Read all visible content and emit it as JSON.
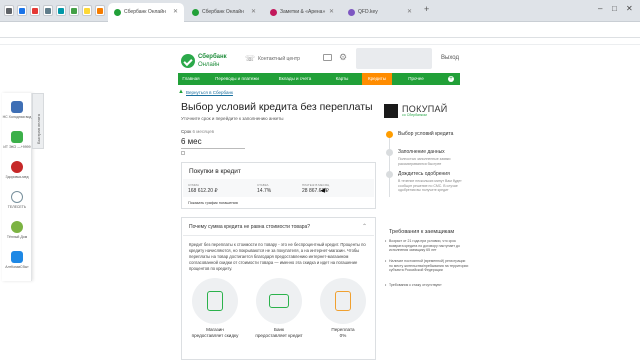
{
  "browser": {
    "tabs": [
      {
        "title": "Сбербанк Онлайн",
        "color": "#21a038",
        "active": true
      },
      {
        "title": "Сбербанк Онлайн",
        "color": "#21a038",
        "active": false
      },
      {
        "title": "Заметки & «Арена»",
        "color": "#c2185b",
        "active": false
      },
      {
        "title": "QFD.key",
        "color": "#7e57c2",
        "active": false
      }
    ],
    "new_tab": "+",
    "window_controls": [
      "–",
      "□",
      "✕"
    ]
  },
  "header": {
    "logo_line1": "Сбербанк",
    "logo_line2": "Онлайн",
    "contact": "Контактный центр",
    "logout": "Выход"
  },
  "nav": {
    "items": [
      "Главная",
      "Переводы и платежи",
      "Вклады и счета",
      "Карты",
      "Кредиты",
      "Прочее"
    ],
    "active_index": 4,
    "plus": "+"
  },
  "breadcrumb": "Вернуться в Сбербанк",
  "sidebar": {
    "tab_label": "Быстрая оплата",
    "items": [
      {
        "label": "НС Холодная вод",
        "color": "#3f6fb5"
      },
      {
        "label": "ИТ ЭКО —+9999",
        "color": "#3cb04a"
      },
      {
        "label": "Здоровья-мед",
        "color": "#c62828"
      },
      {
        "label": "ТЕЛЕСЕТЬ",
        "color": "#78909c"
      },
      {
        "label": "Тёплый Дом",
        "color": "#7cb342"
      },
      {
        "label": "АлтКоммСбыт",
        "color": "#1e88e5"
      }
    ]
  },
  "main": {
    "title": "Выбор условий кредита без переплаты",
    "subtitle": "Уточните срок и перейдите к заполнению анкеты",
    "term_label": "Срок",
    "term_hint": "6 месяцев",
    "term_value": "6 мес",
    "summary": {
      "heading": "Покупки в кредит",
      "cols": [
        {
          "label": "Сумма",
          "value": "168 612.20 ₽"
        },
        {
          "label": "Ставка",
          "value": "14.7%"
        },
        {
          "label": "Платеж в месяц",
          "value": "28 867.63 ₽"
        }
      ],
      "schedule_link": "Показать график погашения"
    },
    "faq": {
      "heading": "Почему сумма кредита не равна стоимости товара?",
      "text": "Кредит без переплаты к стоимости по товару - это не беспроцентный кредит. Проценты по кредиту начисляются, но покрываются не за покупателя, а на интернет-магазин. Чтобы переплаты на товар достигается благодаря предоставлению интернет-магазином согласованной скидки от стоимости товара — именно эта скидка и идет на погашение процентов по кредиту.",
      "features": [
        {
          "line1": "Магазин",
          "line2": "предоставляет скидку",
          "icon": "shop-discount-icon"
        },
        {
          "line1": "Банк",
          "line2": "предоставляет кредит",
          "icon": "bank-card-icon"
        },
        {
          "line1": "Переплата",
          "line2": "0%",
          "icon": "zero-percent-icon"
        }
      ]
    }
  },
  "right": {
    "promo_title": "ПОКУПАЙ",
    "promo_sub": "со Сбербанком",
    "steps": [
      {
        "title": "Выбор условий кредита",
        "desc": "",
        "active": true
      },
      {
        "title": "Заполнение данных",
        "desc": "Полностью заполненные заявки рассматриваются быстрее",
        "active": false
      },
      {
        "title": "Дождитесь одобрения",
        "desc": "В течение нескольких минут Вам будет сообщит решение по СМС. В случае одобрения вы получите кредит",
        "active": false
      }
    ],
    "req_title": "Требования к заемщикам",
    "requirements": [
      "Возраст от 21 года при условии, что срок возврата кредита по договору наступает до исполнения заемщику 65 лет",
      "Наличие постоянной (временной) регистрации по месту жительства/пребывания на территории субъекта Российской Федерации",
      "Требования к стажу отсутствуют"
    ]
  }
}
